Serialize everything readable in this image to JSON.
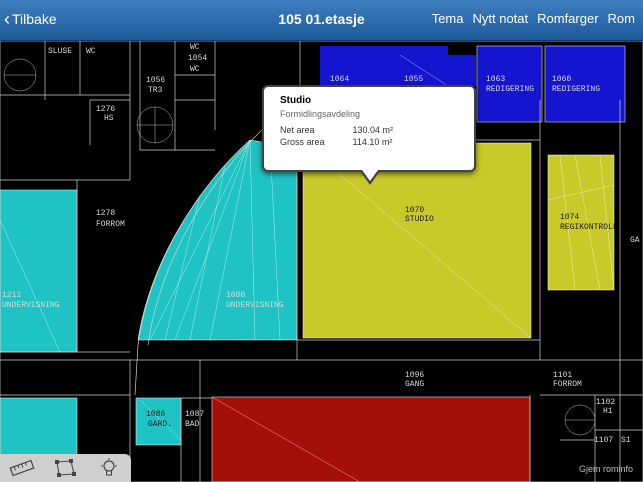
{
  "nav": {
    "back_label": "Tilbake",
    "title": "105 01.etasje",
    "actions": [
      "Tema",
      "Nytt notat",
      "Romfarger",
      "Rom"
    ]
  },
  "rooms": {
    "r1057_sluse": "SLUSE",
    "r1057_wc": "WC",
    "r1054_wc": "WC",
    "r1054_num": "1054",
    "r1054_wc2": "WC",
    "r1056_num": "1056",
    "r1056_name": "TR3",
    "r1276_num": "1276",
    "r1276_name": "HS",
    "r1064_num": "1064",
    "r1055_num": "1055",
    "r1063_num": "1063",
    "r1063_name": "REDIGERING",
    "r1060_num": "1060",
    "r1060_name": "REDIGERING",
    "r1278_num": "1278",
    "r1278_name": "FORROM",
    "r1211_num": "1211",
    "r1211_name": "UNDERVISNING",
    "r1080_num": "1080",
    "r1080_name": "UNDERVISNING",
    "r1070_num": "1070",
    "r1070_name": "STUDIO",
    "r1074_num": "1074",
    "r1074_name": "REGIKONTROLL",
    "r_ga": "GA",
    "r1096_num": "1096",
    "r1096_name": "GANG",
    "r1101_num": "1101",
    "r1101_name": "FORROM",
    "r1086_num": "1086",
    "r1086_name": "GARD.",
    "r1087_num": "1087",
    "r1087_name": "BAD",
    "r1102_num": "1102",
    "r1102_name": "H1",
    "r1107_num": "1107",
    "r1107_name": "S1"
  },
  "popover": {
    "title": "Studio",
    "subtitle": "Formidlingsavdeling",
    "net_label": "Net area",
    "net_value": "130.04 m²",
    "gross_label": "Gross area",
    "gross_value": "114.10 m²"
  },
  "toolbar": {
    "tools": [
      "ruler-icon",
      "polygon-icon",
      "lightbulb-icon"
    ]
  },
  "hide_info_label": "Gjem rominfo",
  "colors": {
    "nav_bar": "#2a6aab",
    "room_blue": "#1515d0",
    "room_cyan": "#20c3c3",
    "room_yellow": "#c9c92a",
    "room_red": "#a50f0a",
    "wall_line": "#ffffff"
  }
}
